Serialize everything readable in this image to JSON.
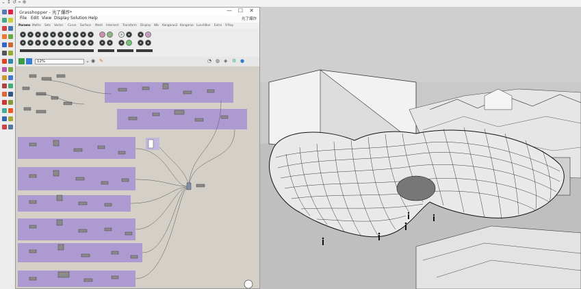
{
  "app": {
    "crumb": "⌄ ↕ ↺ ⌁ ⊕"
  },
  "grasshopper": {
    "title": "Grasshopper - 光了爆炸*",
    "window_controls": [
      "—",
      "☐",
      "✕"
    ],
    "menu": [
      "File",
      "Edit",
      "View",
      "Display",
      "Solution",
      "Help"
    ],
    "menu_right": "光了爆炸",
    "tabs": [
      "Params",
      "Maths",
      "Sets",
      "Vector",
      "Curve",
      "Surface",
      "Mesh",
      "Intersect",
      "Transform",
      "Display",
      "Wb",
      "Kangaroo2",
      "Kangaroo",
      "LunchBox",
      "Extra",
      "V-Ray"
    ],
    "ribbon_groups": [
      "Geometry",
      "Primitive",
      "Input",
      "Util"
    ],
    "zoom": "12%"
  },
  "icons": {
    "save": "save-icon",
    "open": "open-icon",
    "eye": "eye-icon",
    "sphere": "sphere-icon",
    "brush": "brush-icon"
  },
  "colors": {
    "group_fill": "#a994d2",
    "canvas_bg": "#d4d0c8",
    "viewport_bg": "#c9c9c9",
    "ground": "#bfbfbf"
  }
}
